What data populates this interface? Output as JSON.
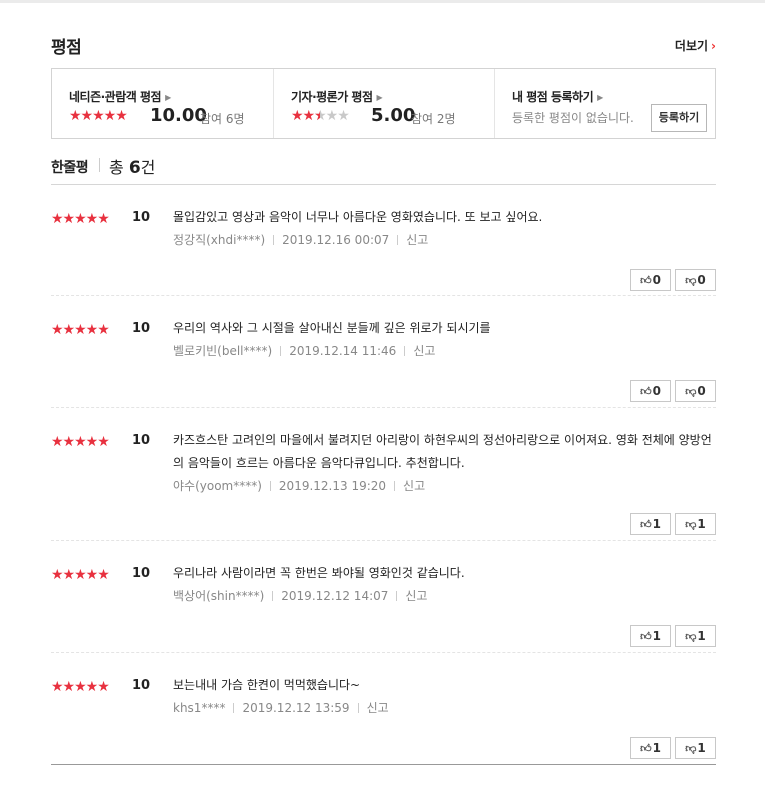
{
  "header": {
    "title": "평점",
    "more_label": "더보기"
  },
  "score_box": {
    "netizen": {
      "label": "네티즌·관람객 평점",
      "score": "10.00",
      "participants": "참여 6명"
    },
    "critic": {
      "label": "기자·평론가 평점",
      "score": "5.00",
      "participants": "참여 2명"
    },
    "mine": {
      "label": "내 평점 등록하기",
      "empty_message": "등록한 평점이 없습니다.",
      "register_label": "등록하기"
    }
  },
  "list_header": {
    "title": "한줄평",
    "total_prefix": "총 ",
    "total_count": "6",
    "total_suffix": "건"
  },
  "reviews": [
    {
      "stars": "★★★★★",
      "score": "10",
      "text": "몰입감있고 영상과 음악이 너무나 아름다운 영화였습니다. 또 보고 싶어요.",
      "author": "정강직(xhdi****)",
      "date": "2019.12.16 00:07",
      "report": "신고",
      "like": "0",
      "dislike": "0"
    },
    {
      "stars": "★★★★★",
      "score": "10",
      "text": "우리의 역사와 그 시절을 살아내신 분들께 깊은 위로가 되시기를",
      "author": "벨로키빈(bell****)",
      "date": "2019.12.14 11:46",
      "report": "신고",
      "like": "0",
      "dislike": "0"
    },
    {
      "stars": "★★★★★",
      "score": "10",
      "text": "카즈흐스탄 고려인의 마을에서 불려지던 아리랑이 하현우씨의 정선아리랑으로 이어져요. 영화 전체에 양방언의 음악들이 흐르는 아름다운 음악다큐입니다. 추천합니다.",
      "author": "야수(yoom****)",
      "date": "2019.12.13 19:20",
      "report": "신고",
      "like": "1",
      "dislike": "1"
    },
    {
      "stars": "★★★★★",
      "score": "10",
      "text": "우리나라 사람이라면 꼭 한번은 봐야될 영화인것 같습니다.",
      "author": "백상어(shin****)",
      "date": "2019.12.12 14:07",
      "report": "신고",
      "like": "1",
      "dislike": "1"
    },
    {
      "stars": "★★★★★",
      "score": "10",
      "text": "보는내내 가슴 한켠이 먹먹했습니다~",
      "author": "khs1****",
      "date": "2019.12.12 13:59",
      "report": "신고",
      "like": "1",
      "dislike": "1"
    }
  ],
  "colors": {
    "star": "#e8313f",
    "accent": "#e33333"
  },
  "icons": {
    "like": "thumbs-up-icon",
    "dislike": "thumbs-down-icon"
  }
}
